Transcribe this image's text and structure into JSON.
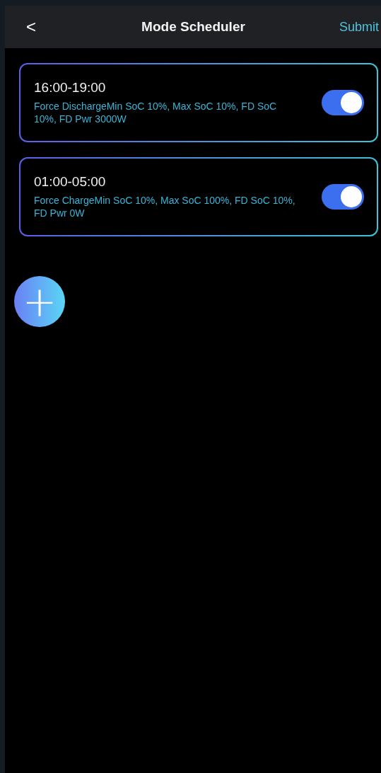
{
  "header": {
    "back": "<",
    "title": "Mode Scheduler",
    "action": "Submit"
  },
  "schedules": [
    {
      "time": "16:00-19:00",
      "details": "Force DischargeMin SoC 10%, Max SoC 10%, FD SoC 10%, FD Pwr 3000W",
      "on": true
    },
    {
      "time": "01:00-05:00",
      "details": "Force ChargeMin SoC 10%, Max SoC 100%, FD SoC 10%, FD Pwr 0W",
      "on": true
    }
  ],
  "add_button": "+"
}
